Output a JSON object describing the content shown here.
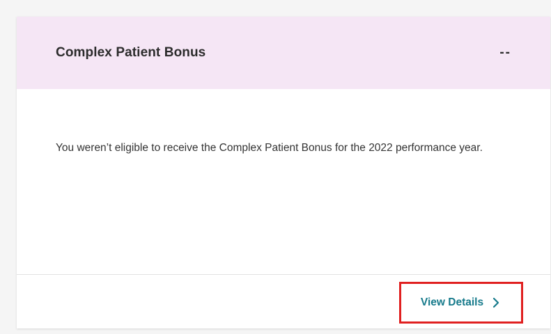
{
  "card": {
    "title": "Complex Patient Bonus",
    "value": "--",
    "message": "You weren’t eligible to receive the Complex Patient Bonus for the 2022 performance year.",
    "footer": {
      "link_label": "View Details",
      "link_icon": "chevron-right-icon"
    }
  },
  "colors": {
    "header_bg": "#f5e6f5",
    "link": "#167a8b",
    "highlight_border": "#e02020"
  }
}
